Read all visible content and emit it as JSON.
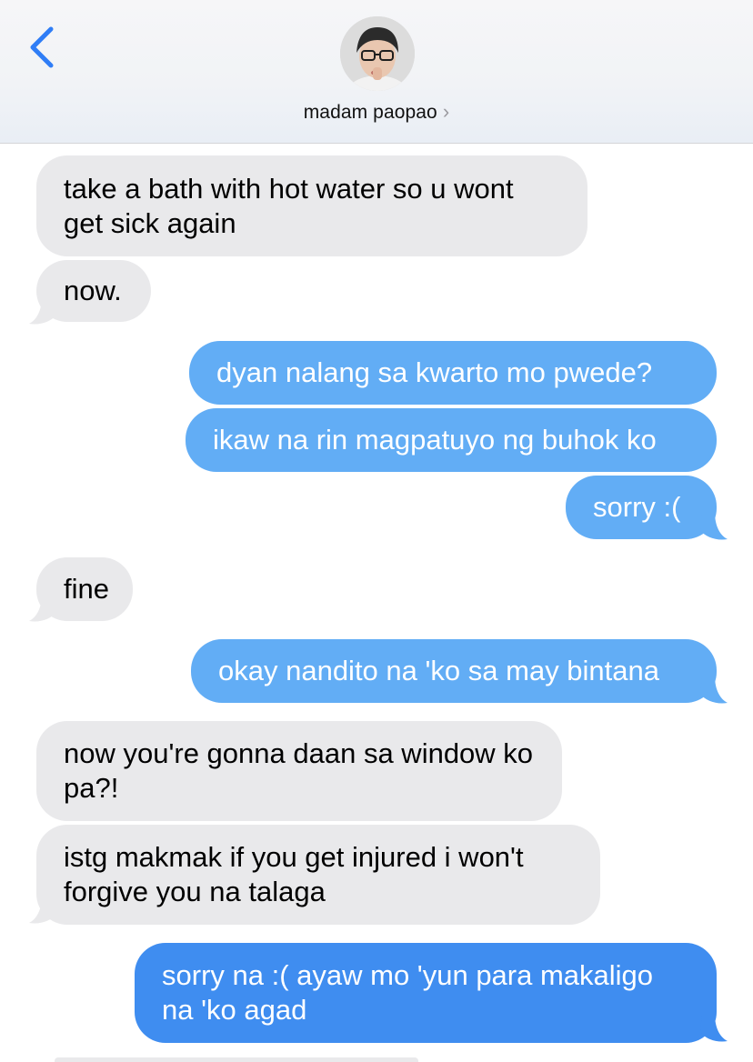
{
  "header": {
    "back_icon": "chevron-left-icon",
    "contact_name": "madam paopao",
    "contact_chevron": "›"
  },
  "colors": {
    "incoming_bubble": "#e9e9eb",
    "outgoing_bubble": "#62adf5",
    "outgoing_bubble_latest": "#3f8df0",
    "accent": "#2f7df6"
  },
  "messages": [
    {
      "from": "them",
      "text": "take a bath with hot water so u wont get sick again"
    },
    {
      "from": "them",
      "text": "now."
    },
    {
      "from": "me",
      "text": "dyan nalang sa kwarto mo pwede?"
    },
    {
      "from": "me",
      "text": "ikaw na rin magpatuyo ng buhok ko"
    },
    {
      "from": "me",
      "text": "sorry :("
    },
    {
      "from": "them",
      "text": "fine"
    },
    {
      "from": "me",
      "text": "okay nandito na 'ko sa may bintana"
    },
    {
      "from": "them",
      "text": "now you're gonna daan sa window ko pa?!"
    },
    {
      "from": "them",
      "text": "istg makmak if you get injured i won't forgive you na talaga"
    },
    {
      "from": "me",
      "text": "sorry na :( ayaw mo 'yun para makaligo na 'ko agad"
    }
  ]
}
